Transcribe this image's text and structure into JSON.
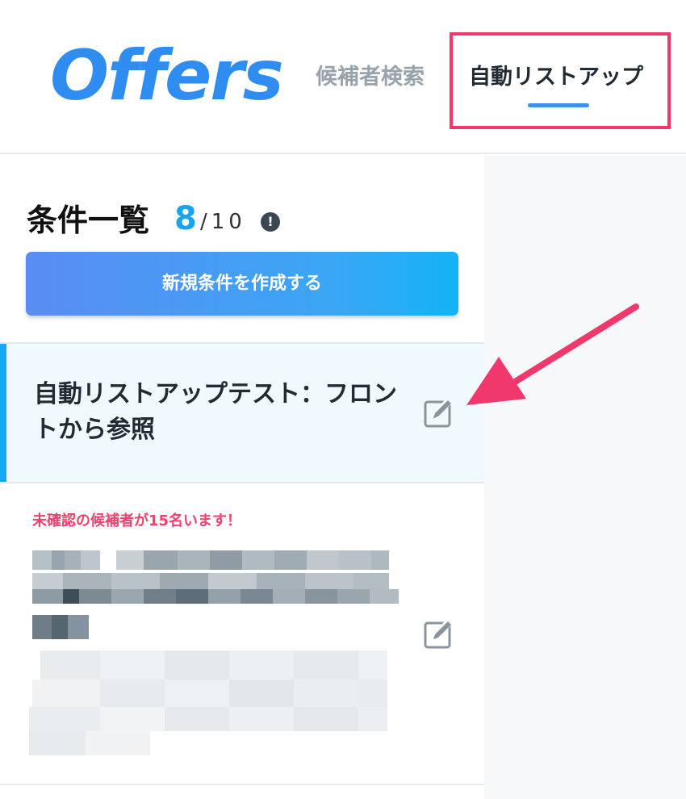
{
  "header": {
    "logo": "Offers",
    "nav": {
      "search_label": "候補者検索",
      "auto_label": "自動リストアップ"
    }
  },
  "panel": {
    "title": "条件一覧",
    "count_current": "8",
    "count_total": "/10",
    "info_icon": "!",
    "create_button": "新規条件を作成する"
  },
  "items": [
    {
      "title": "自動リストアップテスト：フロントから参照",
      "icon": "edit-icon"
    },
    {
      "alert": "未確認の候補者が15名います！",
      "icon": "edit-icon"
    }
  ],
  "colors": {
    "brand_blue": "#2f8df2",
    "accent_blue": "#17a5f2",
    "highlight_pink": "#f0386c",
    "alert_pink": "#f0406e"
  }
}
